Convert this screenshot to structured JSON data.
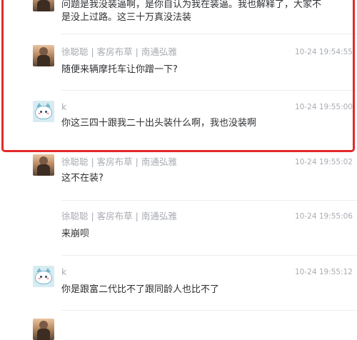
{
  "comments": [
    {
      "avatar": "user-photo-avatar",
      "name": "",
      "time": "",
      "text_lines": [
        "问题是我没装逼啊，是你自认为我在装逼。我也解释了，大家不",
        "是没上过路。这三十万真没法装"
      ]
    },
    {
      "avatar": "user-photo-avatar",
      "name": "徐聪聪 | 客房布草 | 南通弘雅",
      "time": "10-24 19:54:55",
      "text_lines": [
        "随便来辆摩托车让你蹭一下?"
      ]
    },
    {
      "avatar": "cartoon-cat-avatar",
      "name": "k",
      "time": "10-24 19:55:00",
      "text_lines": [
        "你这三四十跟我二十出头装什么啊，我也没装啊"
      ]
    },
    {
      "avatar": "user-photo-avatar",
      "name": "徐聪聪 | 客房布草 | 南通弘雅",
      "time": "10-24 19:55:02",
      "text_lines": [
        "这不在装?"
      ]
    },
    {
      "avatar": "",
      "name": "徐聪聪 | 客房布草 | 南通弘雅",
      "time": "10-24 19:55:06",
      "text_lines": [
        "来崩呗"
      ]
    },
    {
      "avatar": "cartoon-cat-avatar",
      "name": "k",
      "time": "10-24 19:55:12",
      "text_lines": [
        "你是跟富二代比不了跟同龄人也比不了"
      ]
    }
  ],
  "highlight": {
    "color": "#e32a2a"
  }
}
